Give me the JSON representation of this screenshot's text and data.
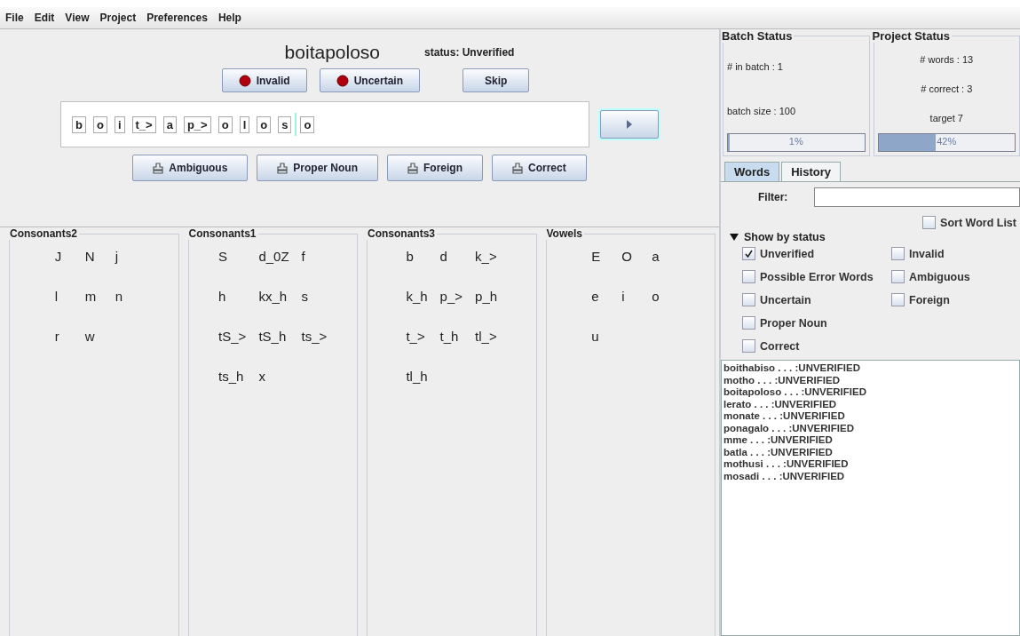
{
  "menu": [
    "File",
    "Edit",
    "View",
    "Project",
    "Preferences",
    "Help"
  ],
  "word": {
    "title": "boitapoloso",
    "status": "status: Unverified"
  },
  "top_buttons": [
    {
      "label": "Invalid",
      "kind": "stop"
    },
    {
      "label": "Uncertain",
      "kind": "stop"
    },
    {
      "label": "Skip",
      "kind": "plain"
    }
  ],
  "segments": [
    {
      "text": "b",
      "caret_after": false
    },
    {
      "text": "o",
      "caret_after": false
    },
    {
      "text": "i",
      "caret_after": false
    },
    {
      "text": "t_>",
      "caret_after": false
    },
    {
      "text": "a",
      "caret_after": false
    },
    {
      "text": "p_>",
      "caret_after": false
    },
    {
      "text": "o",
      "caret_after": false
    },
    {
      "text": "l",
      "caret_after": false
    },
    {
      "text": "o",
      "caret_after": false
    },
    {
      "text": "s",
      "caret_after": true
    },
    {
      "text": "o",
      "caret_after": false
    }
  ],
  "bottom_buttons": [
    {
      "label": "Ambiguous"
    },
    {
      "label": "Proper Noun"
    },
    {
      "label": "Foreign"
    },
    {
      "label": "Correct"
    }
  ],
  "phoneme_groups": [
    {
      "title": "Consonants2",
      "phonemes": [
        "J",
        "N",
        "j",
        "l",
        "m",
        "n",
        "r",
        "w"
      ]
    },
    {
      "title": "Consonants1",
      "phonemes": [
        "S",
        "d_0Z",
        "f",
        "h",
        "kx_h",
        "s",
        "tS_>",
        "tS_h",
        "ts_>",
        "ts_h",
        "x"
      ]
    },
    {
      "title": "Consonants3",
      "phonemes": [
        "b",
        "d",
        "k_>",
        "k_h",
        "p_>",
        "p_h",
        "t_>",
        "t_h",
        "tl_>",
        "tl_h"
      ]
    },
    {
      "title": "Vowels",
      "phonemes": [
        "E",
        "O",
        "a",
        "e",
        "i",
        "o",
        "u"
      ]
    }
  ],
  "batch_status": {
    "title": "Batch Status",
    "lines": [
      "# in batch : 1",
      "batch size : 100"
    ],
    "progress": {
      "level": 0.01,
      "label": "1%"
    }
  },
  "project_status": {
    "title": "Project Status",
    "lines": [
      "# words : 13",
      "# correct : 3",
      "target 7"
    ],
    "progress": {
      "level": 0.42,
      "label": "42%"
    }
  },
  "tabs": [
    {
      "label": "Words",
      "selected": true
    },
    {
      "label": "History",
      "selected": false
    }
  ],
  "filter": {
    "label": "Filter:"
  },
  "sort": {
    "label": "Sort Word List",
    "checked": false
  },
  "show_by_status": {
    "label": "Show by status",
    "expanded": true,
    "left": [
      {
        "label": "Unverified",
        "checked": true
      },
      {
        "label": "Possible Error Words",
        "checked": false
      },
      {
        "label": "Uncertain",
        "checked": false
      },
      {
        "label": "Proper Noun",
        "checked": false
      },
      {
        "label": "Correct",
        "checked": false
      }
    ],
    "right": [
      {
        "label": "Invalid",
        "checked": false
      },
      {
        "label": "Ambiguous",
        "checked": false
      },
      {
        "label": "Foreign",
        "checked": false
      }
    ]
  },
  "word_list": [
    "boithabiso . . . :UNVERIFIED",
    "motho . . . :UNVERIFIED",
    "boitapoloso . . . :UNVERIFIED",
    "lerato . . . :UNVERIFIED",
    "monate . . . :UNVERIFIED",
    "ponagalo . . . :UNVERIFIED",
    "mme . . . :UNVERIFIED",
    "batla . . . :UNVERIFIED",
    "mothusi . . . :UNVERIFIED",
    "mosadi . . . :UNVERIFIED"
  ]
}
